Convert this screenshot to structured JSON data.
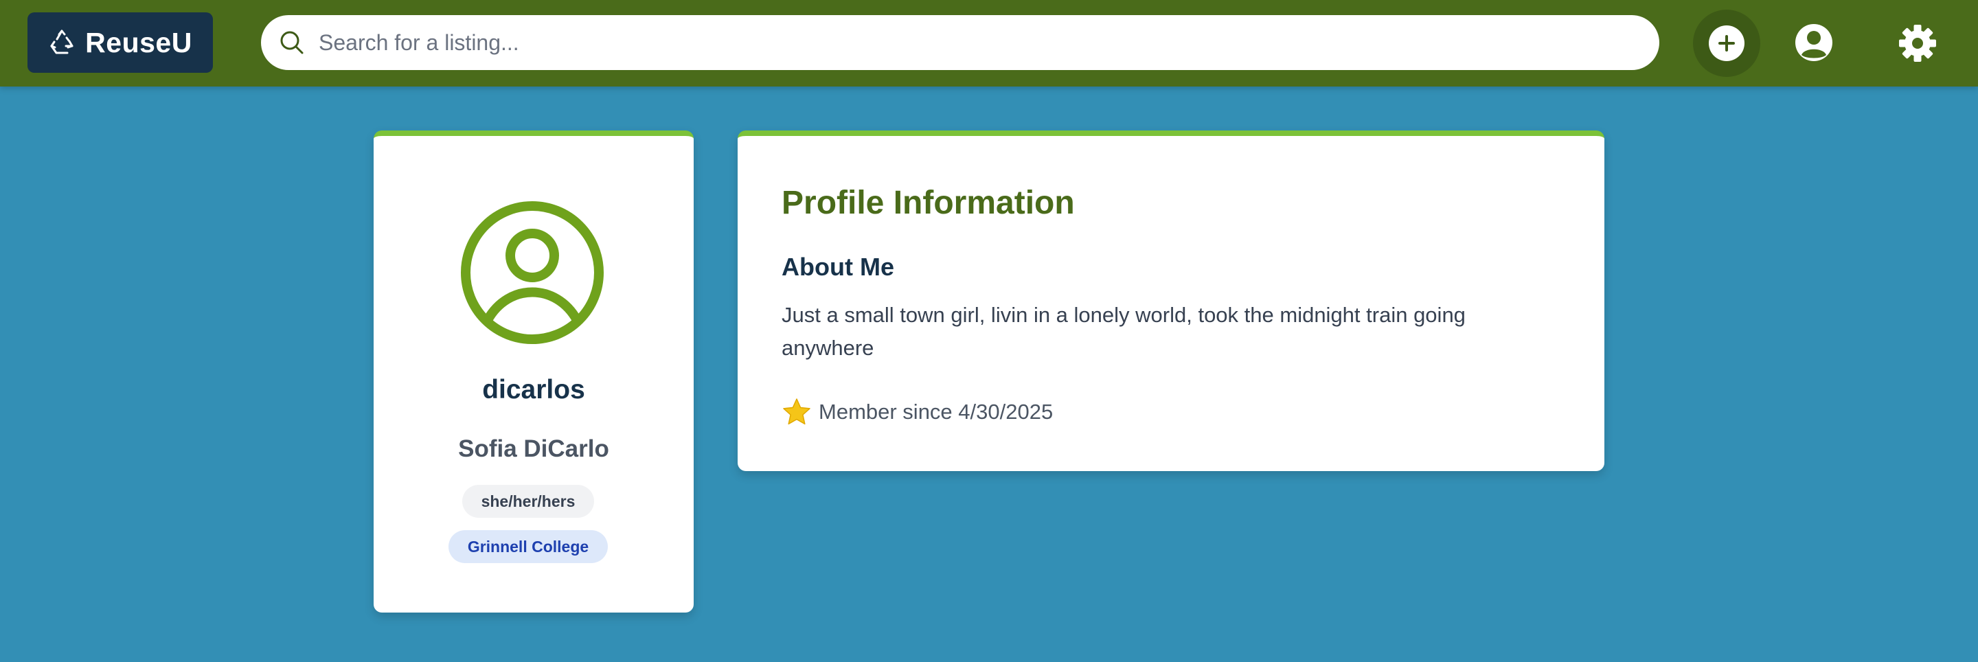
{
  "header": {
    "brand_name": "ReuseU",
    "brand_icon": "recycle-icon",
    "search_placeholder": "Search for a listing...",
    "search_value": "",
    "add_icon": "plus-icon",
    "profile_icon": "user-circle-icon",
    "settings_icon": "gear-icon"
  },
  "profile_card": {
    "avatar_icon": "user-circle-icon",
    "username": "dicarlos",
    "full_name": "Sofia DiCarlo",
    "pronouns": "she/her/hers",
    "college": "Grinnell College"
  },
  "info_card": {
    "title": "Profile Information",
    "about_heading": "About Me",
    "about_text": "Just a small town girl, livin in a lonely world, took the midnight train going anywhere",
    "member_icon": "star-icon",
    "member_since": "Member since 4/30/2025"
  },
  "colors": {
    "page_background": "#338fb5",
    "header_background": "#4a6b1a",
    "brand_background": "#17324a",
    "card_accent": "#7cc238",
    "title_green": "#4a6b1a",
    "avatar_green": "#6fa21c",
    "college_badge_text": "#1e40af",
    "college_badge_bg": "#dde8fa",
    "star": "#f5c518"
  }
}
